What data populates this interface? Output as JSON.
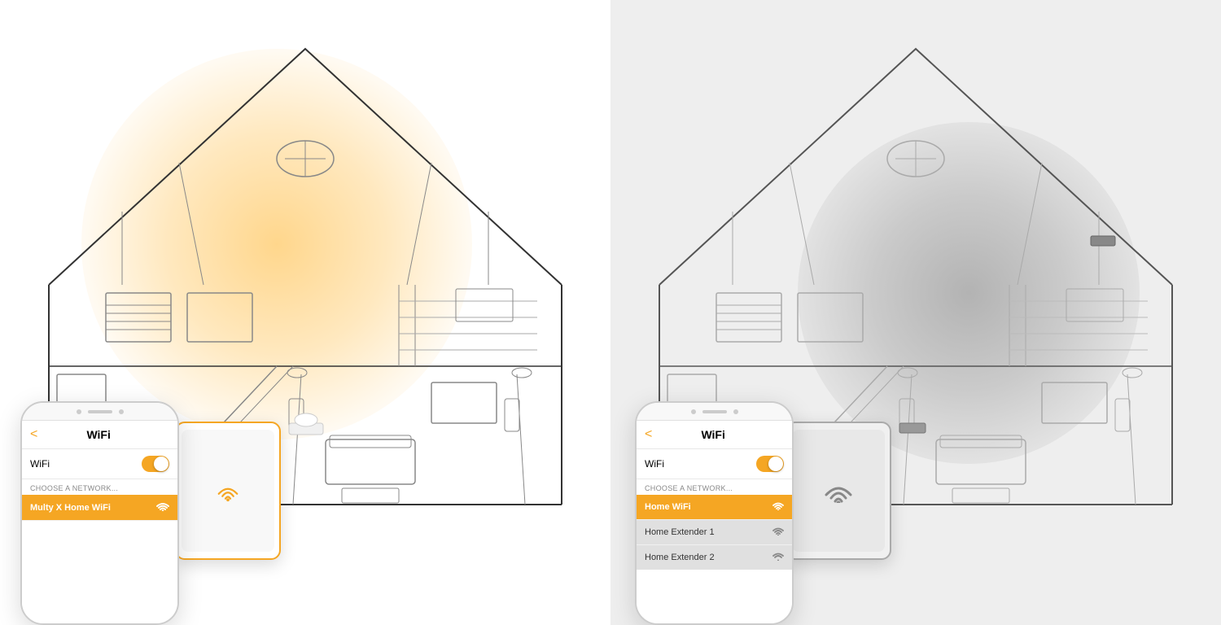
{
  "left_panel": {
    "background": "#ffffff",
    "glow_color": "rgba(245,166,35,0.4)",
    "phone": {
      "back_arrow": "<",
      "title": "WiFi",
      "wifi_label": "WiFi",
      "choose_network": "CHOOSE A NETWORK...",
      "networks": [
        {
          "name": "Multy X Home WiFi",
          "active": true
        }
      ]
    },
    "tablet": {
      "has_orange_border": true
    }
  },
  "right_panel": {
    "background": "#eeeeee",
    "glow_color": "rgba(120,120,120,0.4)",
    "phone": {
      "back_arrow": "<",
      "title": "WiFi",
      "wifi_label": "WiFi",
      "choose_network": "CHOOSE A NETWORK...",
      "networks": [
        {
          "name": "Home WiFi",
          "active": true
        },
        {
          "name": "Home Extender 1",
          "active": false
        },
        {
          "name": "Home Extender 2",
          "active": false
        }
      ]
    },
    "tablet": {
      "has_orange_border": false
    }
  }
}
